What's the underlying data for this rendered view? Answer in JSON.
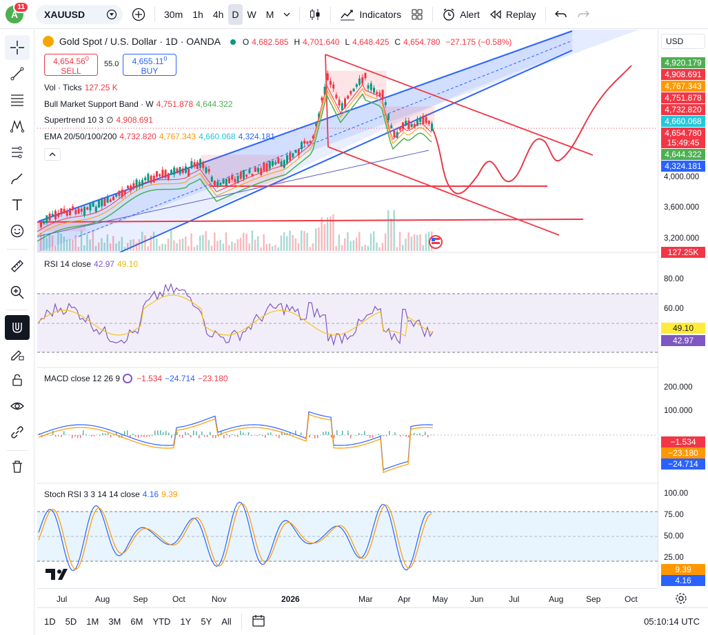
{
  "topbar": {
    "avatar_letter": "A",
    "notif_count": "11",
    "symbol": "XAUUSD",
    "intervals": [
      "30m",
      "1h",
      "4h",
      "D",
      "W",
      "M"
    ],
    "active_interval": "D",
    "indicators": "Indicators",
    "alert": "Alert",
    "replay": "Replay"
  },
  "header": {
    "name": "Gold Spot / U.S. Dollar · 1D · OANDA",
    "o_label": "O",
    "o": "4,682.585",
    "h_label": "H",
    "h": "4,701.640",
    "l_label": "L",
    "l": "4,648.425",
    "c_label": "C",
    "c": "4,654.780",
    "chg": "−27.175 (−0.58%)",
    "sell_price": "4,654.56",
    "sell_sup": "0",
    "sell": "SELL",
    "spread": "55.0",
    "buy_price": "4,655.11",
    "buy_sup": "0",
    "buy": "BUY"
  },
  "indicators": {
    "vol": {
      "name": "Vol · Ticks",
      "v": "127.25 K"
    },
    "bmsb": {
      "name": "Bull Market Support Band · W",
      "v1": "4,751.878",
      "v2": "4,644.322"
    },
    "supertrend": {
      "name": "Supertrend 10 3",
      "sym": "∅",
      "v": "4,908.691"
    },
    "ema": {
      "name": "EMA 20/50/100/200",
      "v1": "4,732.820",
      "v2": "4,767.343",
      "v3": "4,660.068",
      "v4": "4,324.181"
    },
    "rsi": {
      "name": "RSI 14 close",
      "v1": "42.97",
      "v2": "49.10"
    },
    "macd": {
      "name": "MACD close 12 26 9",
      "v1": "−1.534",
      "v2": "−24.714",
      "v3": "−23.180"
    },
    "stoch": {
      "name": "Stoch RSI 3 3 14 14 close",
      "v1": "4.16",
      "v2": "9.39"
    }
  },
  "price_axis": {
    "currency": "USD",
    "ticks": [
      "4,000.000",
      "3,600.000",
      "3,200.000"
    ],
    "rsi_ticks": [
      "80.00",
      "60.00"
    ],
    "macd_ticks": [
      "200.000",
      "100.000"
    ],
    "stoch_ticks": [
      "100.00",
      "75.00",
      "50.00",
      "25.00"
    ],
    "labels": [
      {
        "t": "4,920.179",
        "c": "#4caf50"
      },
      {
        "t": "4,908.691",
        "c": "#f23645"
      },
      {
        "t": "4,767.343",
        "c": "#ff9800"
      },
      {
        "t": "4,751.878",
        "c": "#f23645"
      },
      {
        "t": "4,732.820",
        "c": "#f23645"
      },
      {
        "t": "4,660.068",
        "c": "#26c6da"
      },
      {
        "t": "4,654.780",
        "c": "#f23645"
      },
      {
        "t": "15:49:45",
        "c": "#f23645"
      },
      {
        "t": "4,644.322",
        "c": "#4caf50"
      },
      {
        "t": "4,324.181",
        "c": "#2962ff"
      },
      {
        "t": "127.25K",
        "c": "#f23645"
      },
      {
        "t": "49.10",
        "c": "#ffeb3b"
      },
      {
        "t": "42.97",
        "c": "#7e57c2"
      },
      {
        "t": "−1.534",
        "c": "#f23645"
      },
      {
        "t": "−23.180",
        "c": "#ff9800"
      },
      {
        "t": "−24.714",
        "c": "#2962ff"
      },
      {
        "t": "9.39",
        "c": "#ff9800"
      },
      {
        "t": "4.16",
        "c": "#2962ff"
      }
    ]
  },
  "time_axis": [
    "Jul",
    "Aug",
    "Sep",
    "Oct",
    "Nov",
    "2026",
    "Mar",
    "Apr",
    "May",
    "Jun",
    "Jul",
    "Aug",
    "Sep",
    "Oct"
  ],
  "bottombar": {
    "ranges": [
      "1D",
      "5D",
      "1M",
      "3M",
      "6M",
      "YTD",
      "1Y",
      "5Y",
      "All"
    ],
    "clock": "05:10:14 UTC"
  }
}
